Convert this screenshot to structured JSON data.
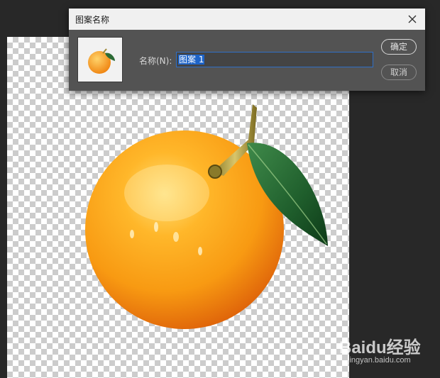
{
  "dialog": {
    "title": "图案名称",
    "name_label": "名称(N):",
    "name_value": "图案 1",
    "ok_label": "确定",
    "cancel_label": "取消",
    "close_icon": "close-icon",
    "thumbnail_icon": "orange-thumbnail"
  },
  "canvas": {
    "background": "transparency-checkerboard",
    "artwork": "orange-with-leaf"
  },
  "watermark": {
    "brand": "Baidu经验",
    "url": "jingyan.baidu.com"
  },
  "colors": {
    "app_background": "#282828",
    "dialog_background": "#535353",
    "titlebar": "#f0f0f0",
    "selection": "#1e64c8",
    "input_border": "#2f6fc6"
  }
}
